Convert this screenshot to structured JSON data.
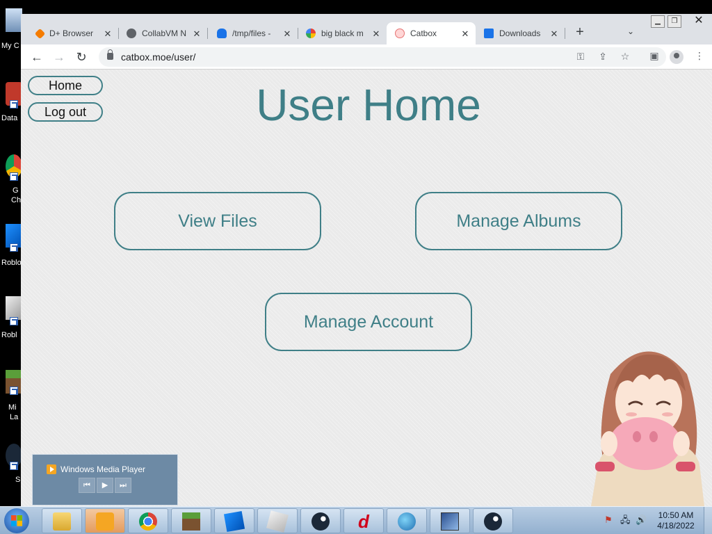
{
  "desktop": {
    "labels": [
      "My C",
      "Data",
      "G",
      "Ch",
      "Roblo",
      "Robl",
      "Mi",
      "La",
      "S"
    ]
  },
  "browser": {
    "tabs": [
      {
        "title": "D+ Browser",
        "favicon_color": "#f57c00"
      },
      {
        "title": "CollabVM N",
        "favicon_color": "#5f6368"
      },
      {
        "title": "/tmp/files -",
        "favicon_color": "#1a73e8"
      },
      {
        "title": "big black m",
        "favicon_color": "#4285f4"
      },
      {
        "title": "Catbox",
        "favicon_color": "#e57373",
        "active": true
      },
      {
        "title": "Downloads",
        "favicon_color": "#1a73e8"
      }
    ],
    "close_glyph": "✕",
    "new_tab_glyph": "+",
    "tab_menu_glyph": "⌄",
    "nav": {
      "back": "←",
      "forward": "→",
      "reload": "↻"
    },
    "url": "catbox.moe/user/",
    "window_controls": {
      "minimize": "▁",
      "restore": "❐",
      "close": "✕"
    }
  },
  "page": {
    "nav": {
      "home_label": "Home",
      "logout_label": "Log out"
    },
    "title": "User Home",
    "buttons": {
      "view_files": "View Files",
      "manage_albums": "Manage Albums",
      "manage_account": "Manage Account"
    },
    "accent_color": "#3f7f87"
  },
  "wmp": {
    "title": "Windows Media Player",
    "controls": {
      "prev": "⏮",
      "play": "▶",
      "next": "⏭"
    }
  },
  "taskbar": {
    "apps": [
      "file-explorer",
      "windows-media-player",
      "chrome",
      "minecraft",
      "roblox-studio",
      "roblox",
      "steam",
      "d-plus-browser",
      "d-plus-globe",
      "display-settings",
      "steam"
    ],
    "clock": {
      "time": "10:50 AM",
      "date": "4/18/2022"
    }
  }
}
